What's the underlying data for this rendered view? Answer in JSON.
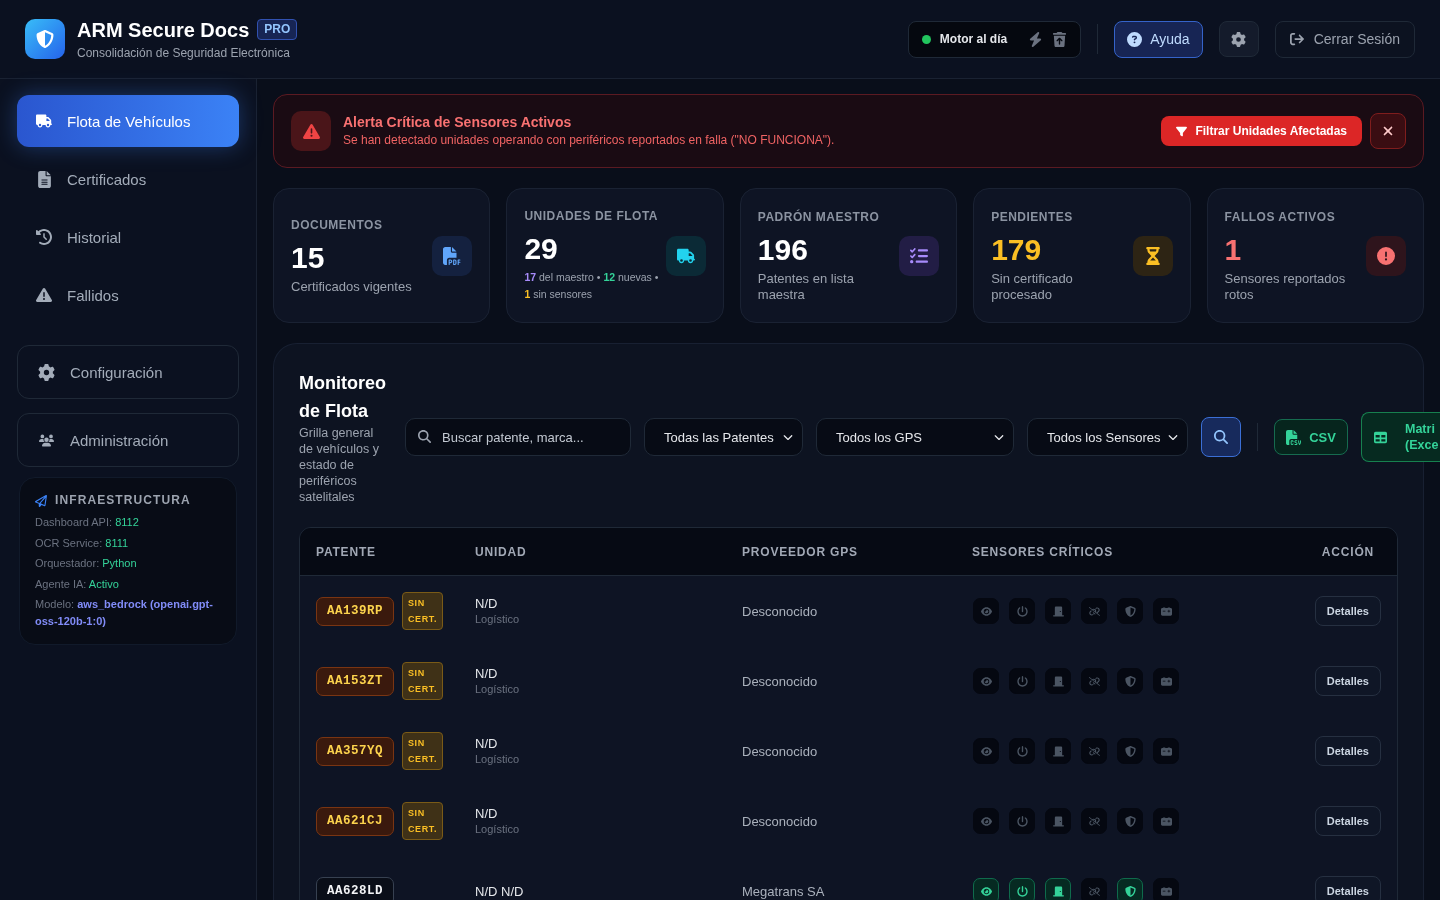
{
  "header": {
    "title": "ARM Secure Docs",
    "badge": "PRO",
    "subtitle": "Consolidación de Seguridad Electrónica",
    "status": {
      "label": "Motor al día",
      "color": "#22c55e"
    },
    "help_button": "Ayuda",
    "logout_button": "Cerrar Sesión"
  },
  "sidebar": {
    "items": [
      {
        "label": "Flota de Vehículos",
        "selected": true
      },
      {
        "label": "Certificados",
        "selected": false
      },
      {
        "label": "Historial",
        "selected": false
      },
      {
        "label": "Fallidos",
        "selected": false
      }
    ],
    "secondary_items": [
      {
        "label": "Configuración",
        "selected": false
      },
      {
        "label": "Administración",
        "selected": false
      }
    ],
    "infrastructure": {
      "title": "INFRAESTRUCTURA",
      "entries": [
        {
          "label": "Dashboard API:",
          "value": "8112",
          "color": "#34d399",
          "strong": false
        },
        {
          "label": "OCR Service:",
          "value": "8111",
          "color": "#34d399",
          "strong": false
        },
        {
          "label": "Orquestador:",
          "value": "Python",
          "color": "#34d399",
          "strong": false
        },
        {
          "label": "Agente IA:",
          "value": "Activo",
          "color": "#34d399",
          "strong": false
        },
        {
          "label": "Modelo:",
          "value": "aws_bedrock (openai.gpt-oss-120b-1:0)",
          "color": "#818cf8",
          "strong": true
        }
      ]
    }
  },
  "alert": {
    "title": "Alerta Crítica de Sensores Activos",
    "message": "Se han detectado unidades operando con periféricos reportados en falla (\"NO FUNCIONA\").",
    "action": "Filtrar Unidades Afectadas"
  },
  "stats": [
    {
      "kind": "documents",
      "label": "DOCUMENTOS",
      "value": "15",
      "color": "#ffffff",
      "caption": "Certificados vigentes"
    },
    {
      "kind": "fleet",
      "label": "UNIDADES DE FLOTA",
      "value": "29",
      "color": "#ffffff",
      "separator": "•",
      "breakdown": [
        {
          "value": "17",
          "text": "del maestro",
          "color": "#a78bfa"
        },
        {
          "value": "12",
          "text": "nuevas",
          "color": "#34d399"
        },
        {
          "value": "1",
          "text": "sin sensores",
          "color": "#fbbf24"
        }
      ]
    },
    {
      "kind": "master",
      "label": "PADRÓN MAESTRO",
      "value": "196",
      "color": "#ffffff",
      "caption": "Patentes en lista maestra"
    },
    {
      "kind": "pending",
      "label": "PENDIENTES",
      "value": "179",
      "color": "#fbbf24",
      "caption": "Sin certificado procesado"
    },
    {
      "kind": "failures",
      "label": "FALLOS ACTIVOS",
      "value": "1",
      "color": "#f87171",
      "caption": "Sensores reportados rotos"
    }
  ],
  "monitor": {
    "title": "Monitoreo de Flota",
    "description": "Grilla general de vehículos y estado de periféricos satelitales",
    "search": {
      "placeholder": "Buscar patente, marca..."
    },
    "filters": [
      "Todas las Patentes",
      "Todos los GPS",
      "Todos los Sensores"
    ],
    "csv_button": "CSV",
    "excel_button": "Matri (Exce",
    "table": {
      "columns": [
        "PATENTE",
        "UNIDAD",
        "PROVEEDOR GPS",
        "SENSORES CRÍTICOS",
        "ACCIÓN"
      ],
      "rows": [
        {
          "plate": "AA139RP",
          "certified": false,
          "badge": "SIN CERT.",
          "unit": "N/D",
          "unit_type": "Logístico",
          "gps": "Desconocido",
          "sensors": [
            {
              "on": false
            },
            {
              "on": false
            },
            {
              "on": false
            },
            {
              "on": false
            },
            {
              "on": false
            },
            {
              "on": false
            }
          ],
          "action": "Detalles"
        },
        {
          "plate": "AA153ZT",
          "certified": false,
          "badge": "SIN CERT.",
          "unit": "N/D",
          "unit_type": "Logístico",
          "gps": "Desconocido",
          "sensors": [
            {
              "on": false
            },
            {
              "on": false
            },
            {
              "on": false
            },
            {
              "on": false
            },
            {
              "on": false
            },
            {
              "on": false
            }
          ],
          "action": "Detalles"
        },
        {
          "plate": "AA357YQ",
          "certified": false,
          "badge": "SIN CERT.",
          "unit": "N/D",
          "unit_type": "Logístico",
          "gps": "Desconocido",
          "sensors": [
            {
              "on": false
            },
            {
              "on": false
            },
            {
              "on": false
            },
            {
              "on": false
            },
            {
              "on": false
            },
            {
              "on": false
            }
          ],
          "action": "Detalles"
        },
        {
          "plate": "AA621CJ",
          "certified": false,
          "badge": "SIN CERT.",
          "unit": "N/D",
          "unit_type": "Logístico",
          "gps": "Desconocido",
          "sensors": [
            {
              "on": false
            },
            {
              "on": false
            },
            {
              "on": false
            },
            {
              "on": false
            },
            {
              "on": false
            },
            {
              "on": false
            }
          ],
          "action": "Detalles"
        },
        {
          "plate": "AA628LD",
          "certified": true,
          "unit": "N/D N/D",
          "gps": "Megatrans SA",
          "sensors": [
            {
              "on": true
            },
            {
              "on": true
            },
            {
              "on": true
            },
            {
              "on": false
            },
            {
              "on": true
            },
            {
              "on": false
            }
          ],
          "action": "Detalles"
        }
      ]
    }
  }
}
